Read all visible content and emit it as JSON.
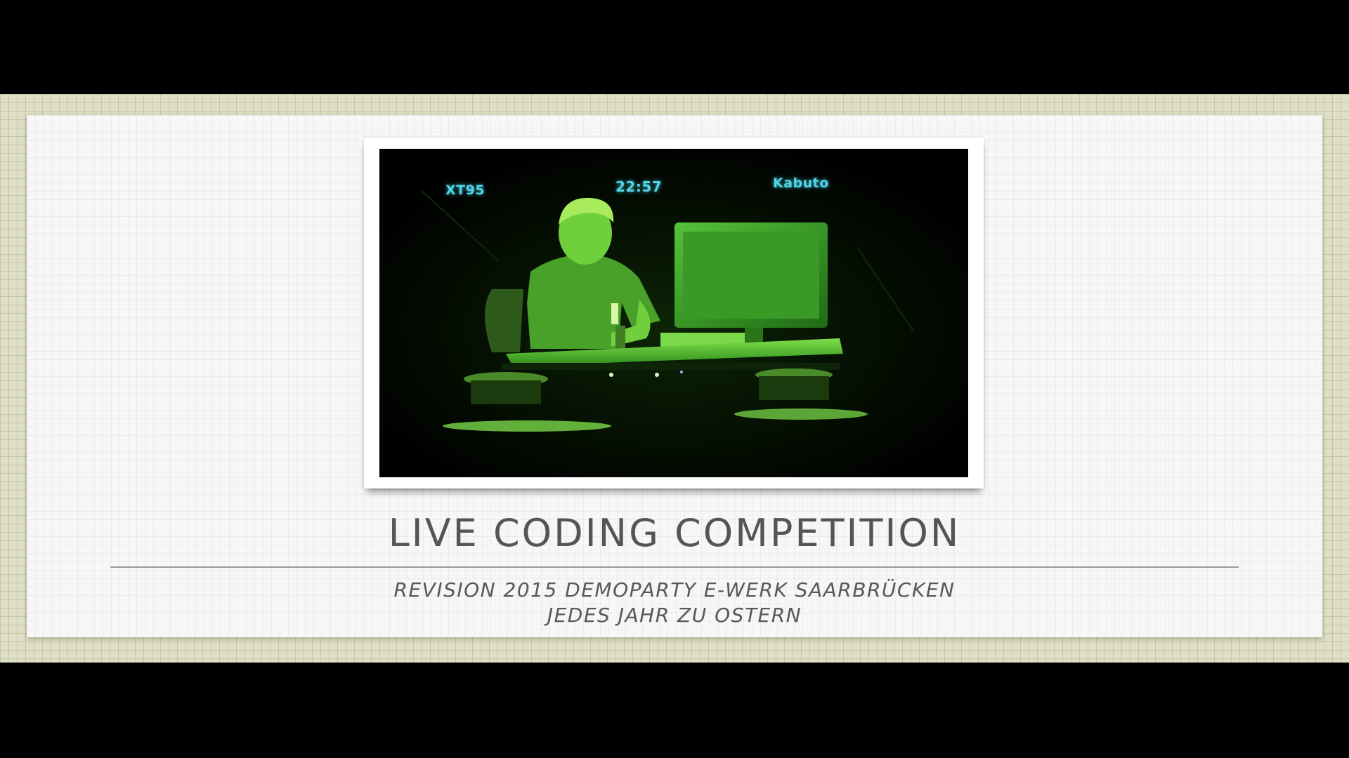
{
  "slide": {
    "title": "LIVE CODING COMPETITION",
    "subtitle_line1": "REVISION 2015 DEMOPARTY E-WERK SAARBRÜCKEN",
    "subtitle_line2": "JEDES JAHR ZU OSTERN"
  },
  "photo": {
    "hud_left": "XT95",
    "hud_center": "22:57",
    "hud_right": "Kabuto"
  },
  "colors": {
    "slide_background": "#dfdfc6",
    "card": "#f7f7f5",
    "title_text": "#555555",
    "hud_text": "#4fd6e8",
    "photo_tint": "#7ad84a"
  }
}
